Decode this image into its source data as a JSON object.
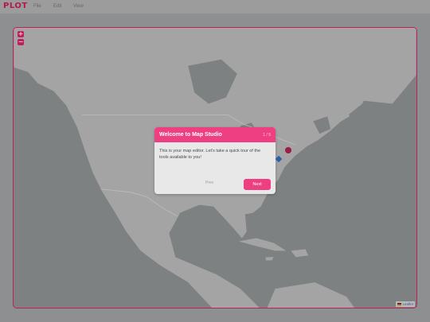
{
  "app": {
    "brand": "PLOT"
  },
  "menu": {
    "file": "File",
    "edit": "Edit",
    "view": "View"
  },
  "map": {
    "zoom_in": "+",
    "zoom_out": "−",
    "attribution": "Leaflet"
  },
  "dialog": {
    "title": "Welcome to Map Studio",
    "step": "1 / 5",
    "body": "This is your map editor. Let's take a quick tour of the tools available to you!",
    "prev_label": "Prev",
    "next_label": "Next"
  },
  "colors": {
    "brand": "#b3184f",
    "accent": "#ee3f82",
    "frame": "#c01f5e",
    "water": "#7e8182",
    "land": "#a4a4a4"
  },
  "icons": {
    "attribution_flag": "ukraine-flag-icon"
  }
}
